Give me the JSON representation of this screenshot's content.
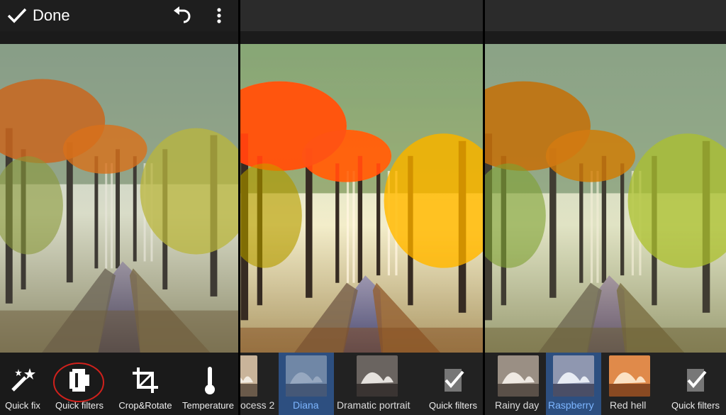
{
  "panel1": {
    "done_label": "Done",
    "tools": [
      {
        "label": "Quick fix",
        "icon": "magic-wand-icon"
      },
      {
        "label": "Quick filters",
        "icon": "film-roll-icon"
      },
      {
        "label": "Crop&Rotate",
        "icon": "crop-icon"
      },
      {
        "label": "Temperature",
        "icon": "thermometer-icon"
      }
    ]
  },
  "panel2": {
    "filters": [
      {
        "label": "ocess 2"
      },
      {
        "label": "Diana"
      },
      {
        "label": "Dramatic portrait"
      }
    ],
    "quick_filters_label": "Quick filters"
  },
  "panel3": {
    "filters": [
      {
        "label": "Rainy day"
      },
      {
        "label": "Raspberry"
      },
      {
        "label": "Red hell"
      }
    ],
    "quick_filters_label": "Quick filters"
  },
  "colors": {
    "selected_bg": "#2d4f80",
    "selected_text": "#7db6ff",
    "highlight_circle": "#d0211c"
  }
}
